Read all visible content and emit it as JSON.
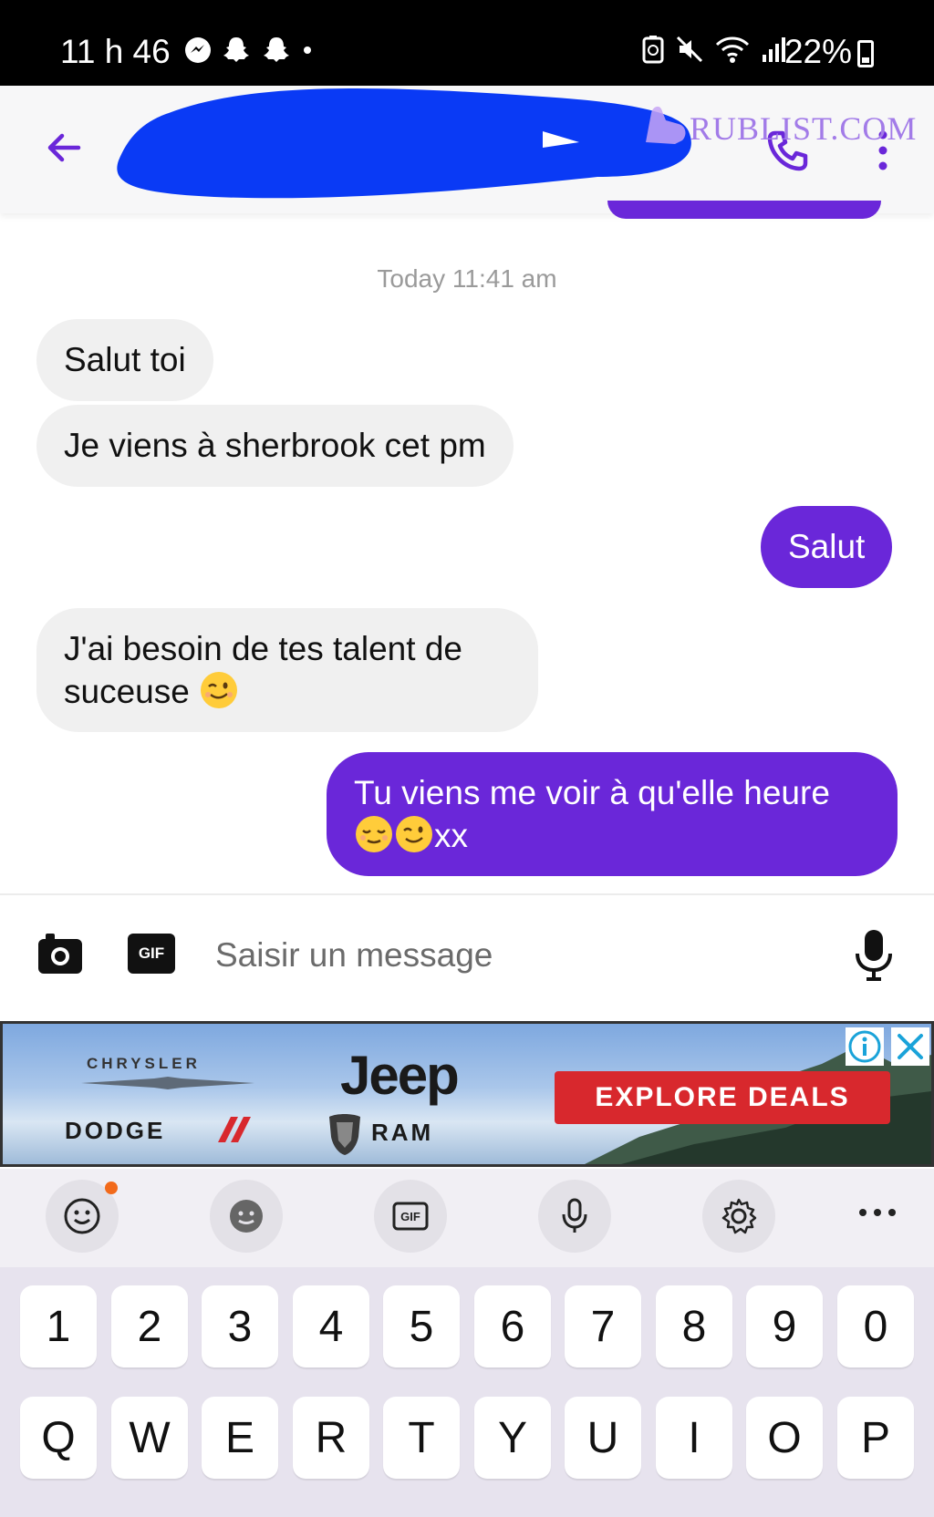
{
  "status_bar": {
    "time": "11 h 46",
    "battery": "22%"
  },
  "header": {
    "watermark": "RUBLIST.COM"
  },
  "conversation": {
    "timestamp": "Today 11:41 am",
    "messages": [
      {
        "direction": "incoming",
        "text": "Salut toi"
      },
      {
        "direction": "incoming",
        "text": "Je viens à sherbrook cet pm"
      },
      {
        "direction": "outgoing",
        "text": "Salut"
      },
      {
        "direction": "incoming",
        "text": "J'ai besoin de tes talent de",
        "text_line2": "suceuse",
        "emojis": [
          "winking-face"
        ]
      },
      {
        "direction": "outgoing",
        "text": "Tu viens me voir à qu'elle heure",
        "emojis": [
          "relieved-face",
          "winking-face"
        ],
        "text_suffix": "xx"
      }
    ]
  },
  "composer": {
    "gif_label": "GIF",
    "placeholder": "Saisir un message"
  },
  "ad": {
    "brand_chrysler": "CHRYSLER",
    "brand_jeep": "Jeep",
    "brand_dodge": "DODGE",
    "brand_ram": "RAM",
    "cta": "EXPLORE DEALS"
  },
  "keyboard_toolbar": {
    "gif_label": "GIF",
    "tools": [
      "emoji-icon",
      "sticker-icon",
      "gif-icon",
      "voice-input-icon",
      "settings-icon",
      "more-icon"
    ]
  },
  "keyboard": {
    "number_row": [
      "1",
      "2",
      "3",
      "4",
      "5",
      "6",
      "7",
      "8",
      "9",
      "0"
    ],
    "letter_row": [
      "Q",
      "W",
      "E",
      "R",
      "T",
      "Y",
      "U",
      "I",
      "O",
      "P"
    ]
  },
  "colors": {
    "accent": "#6a27d9",
    "incoming_bubble": "#f0f0f0",
    "ad_cta": "#d8282d"
  }
}
